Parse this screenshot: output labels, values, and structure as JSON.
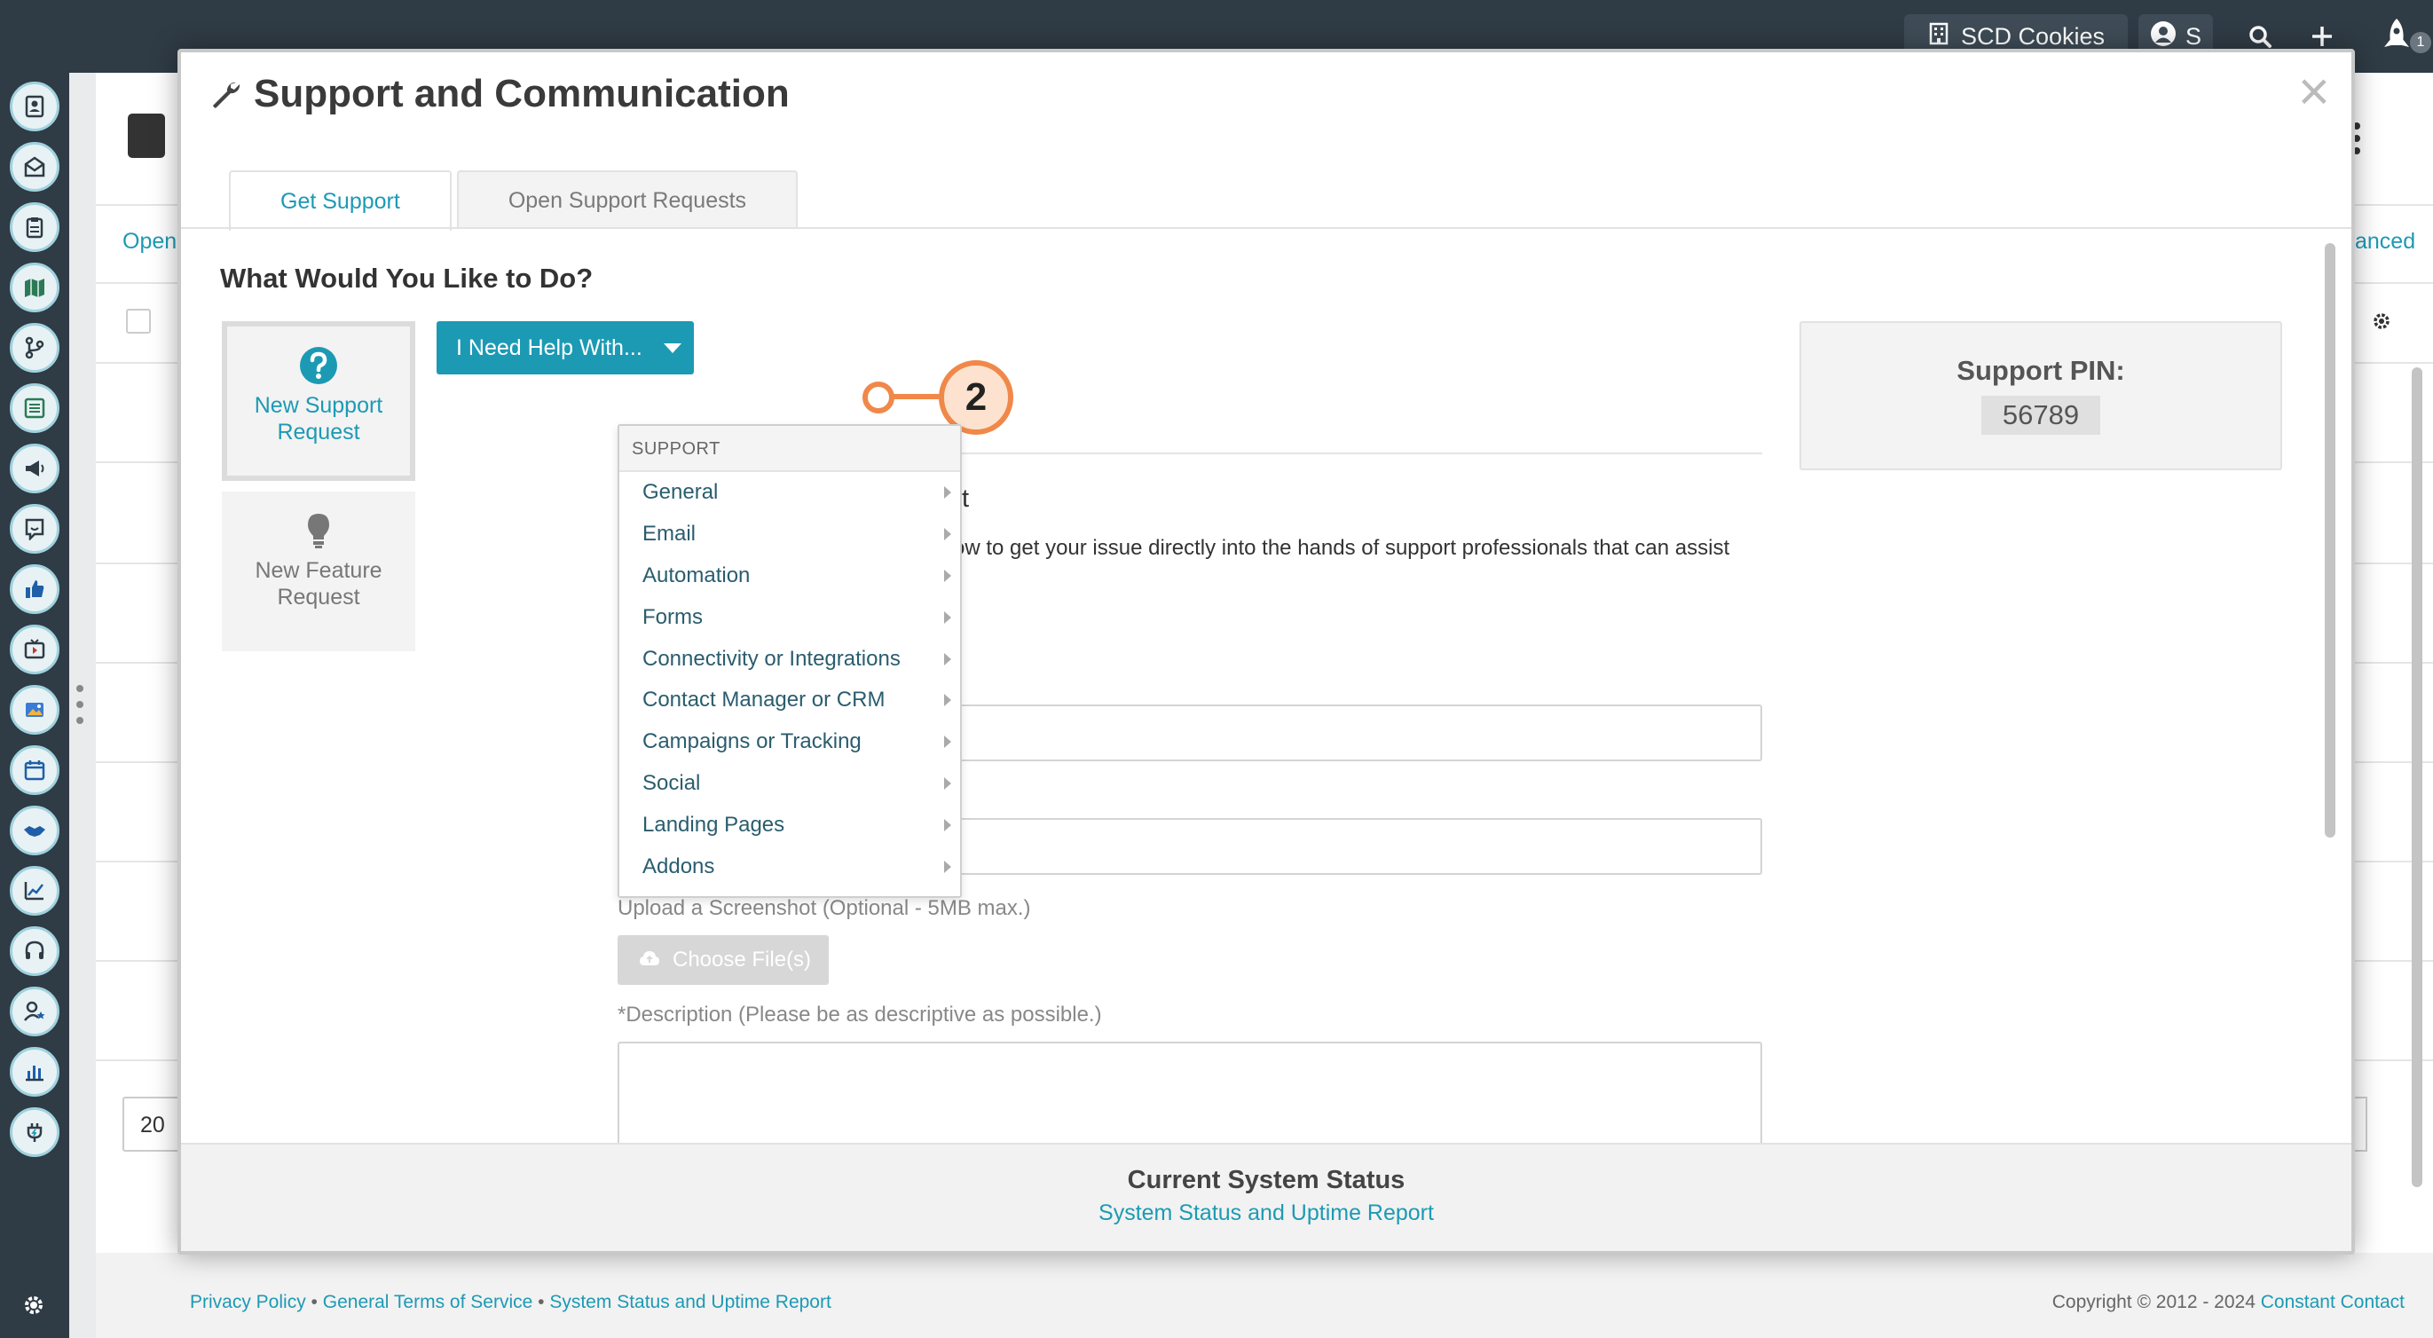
{
  "topbar": {
    "company": "SCD Cookies",
    "user_initial": "S",
    "notification_count": "1"
  },
  "background": {
    "open_fragment": "Open",
    "advanced_fragment": "anced",
    "page_size": "20"
  },
  "footer": {
    "privacy": "Privacy Policy",
    "terms": "General Terms of Service",
    "status": "System Status and Uptime Report",
    "copyright": "Copyright © 2012 - 2024",
    "brand": "Constant Contact",
    "separator": "•"
  },
  "modal": {
    "title": "Support and Communication",
    "close": "×",
    "tabs": [
      "Get Support",
      "Open Support Requests"
    ],
    "heading": "What Would You Like to Do?",
    "cards": {
      "support_line1": "New Support",
      "support_line2": "Request",
      "feature_line1": "New Feature",
      "feature_line2": "Request"
    },
    "help_button": "I Need Help With...",
    "marker": "2",
    "partial_heading": "t",
    "partial_text": "ow to get your issue directly into the hands of support professionals that can assist",
    "upload_label": "Upload a Screenshot (Optional - 5MB max.)",
    "choose_files": "Choose File(s)",
    "description_label": "*Description (Please be as descriptive as possible.)",
    "pin_label": "Support PIN:",
    "pin_value": "56789",
    "dropdown": {
      "header": "SUPPORT",
      "items": [
        "General",
        "Email",
        "Automation",
        "Forms",
        "Connectivity or Integrations",
        "Contact Manager or CRM",
        "Campaigns or Tracking",
        "Social",
        "Landing Pages",
        "Addons"
      ]
    },
    "footer_title": "Current System Status",
    "footer_link": "System Status and Uptime Report"
  },
  "colors": {
    "accent": "#1c9ab4",
    "marker": "#f0884a",
    "sidebar": "#2f3b45"
  }
}
